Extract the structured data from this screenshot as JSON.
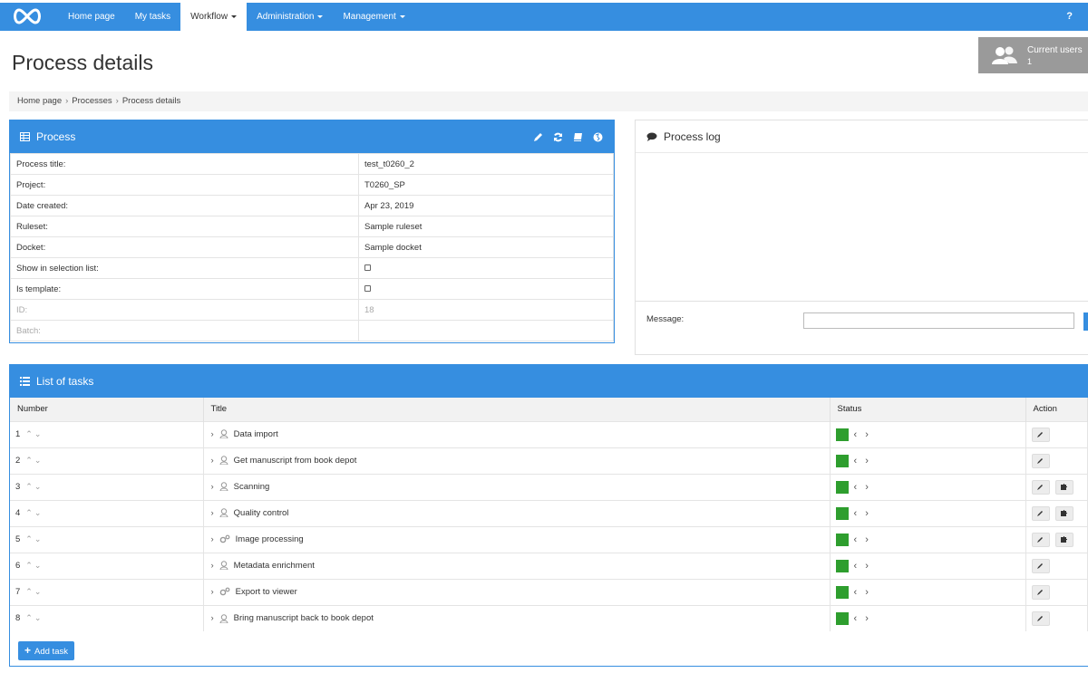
{
  "nav": {
    "items": [
      {
        "label": "Home page",
        "active": false,
        "dropdown": false
      },
      {
        "label": "My tasks",
        "active": false,
        "dropdown": false
      },
      {
        "label": "Workflow",
        "active": true,
        "dropdown": true
      },
      {
        "label": "Administration",
        "active": false,
        "dropdown": true
      },
      {
        "label": "Management",
        "active": false,
        "dropdown": true
      }
    ],
    "help_label": "?",
    "logo_icon": "infinity-logo"
  },
  "page": {
    "title": "Process details"
  },
  "current_users": {
    "label": "Current users",
    "count": "1",
    "icon": "users-icon"
  },
  "breadcrumb": [
    "Home page",
    "Processes",
    "Process details"
  ],
  "process_panel": {
    "title": "Process",
    "actions": [
      "edit-icon",
      "refresh-icon",
      "book-icon",
      "globe-icon"
    ],
    "rows": [
      {
        "label": "Process title:",
        "value": "test_t0260_2",
        "type": "text",
        "dim": false
      },
      {
        "label": "Project:",
        "value": "T0260_SP",
        "type": "text",
        "dim": false
      },
      {
        "label": "Date created:",
        "value": "Apr 23, 2019",
        "type": "text",
        "dim": false
      },
      {
        "label": "Ruleset:",
        "value": "Sample ruleset",
        "type": "text",
        "dim": false
      },
      {
        "label": "Docket:",
        "value": "Sample docket",
        "type": "text",
        "dim": false
      },
      {
        "label": "Show in selection list:",
        "value": "",
        "type": "checkbox",
        "dim": false
      },
      {
        "label": "Is template:",
        "value": "",
        "type": "checkbox",
        "dim": false
      },
      {
        "label": "ID:",
        "value": "18",
        "type": "text",
        "dim": true
      },
      {
        "label": "Batch:",
        "value": "",
        "type": "text",
        "dim": true
      }
    ]
  },
  "process_log": {
    "title": "Process log",
    "message_label": "Message:",
    "message_value": ""
  },
  "tasks_panel": {
    "title": "List of tasks",
    "columns": [
      "Number",
      "Title",
      "Status",
      "Action"
    ],
    "status_color": "#2e9e2e",
    "rows": [
      {
        "number": "1",
        "title": "Data import",
        "icon": "user-icon",
        "actions": [
          "edit"
        ]
      },
      {
        "number": "2",
        "title": "Get manuscript from book depot",
        "icon": "user-icon",
        "actions": [
          "edit"
        ]
      },
      {
        "number": "3",
        "title": "Scanning",
        "icon": "user-icon",
        "actions": [
          "edit",
          "plugin"
        ]
      },
      {
        "number": "4",
        "title": "Quality control",
        "icon": "user-icon",
        "actions": [
          "edit",
          "plugin"
        ]
      },
      {
        "number": "5",
        "title": "Image processing",
        "icon": "gears-icon",
        "actions": [
          "edit",
          "plugin"
        ]
      },
      {
        "number": "6",
        "title": "Metadata enrichment",
        "icon": "user-icon",
        "actions": [
          "edit"
        ]
      },
      {
        "number": "7",
        "title": "Export to viewer",
        "icon": "gears-icon",
        "actions": [
          "edit"
        ]
      },
      {
        "number": "8",
        "title": "Bring manuscript back to book depot",
        "icon": "user-icon",
        "actions": [
          "edit"
        ]
      }
    ],
    "add_label": "Add task"
  },
  "colors": {
    "primary": "#368ee0",
    "status_done": "#2e9e2e",
    "current_users_bg": "#9a9a9a"
  }
}
